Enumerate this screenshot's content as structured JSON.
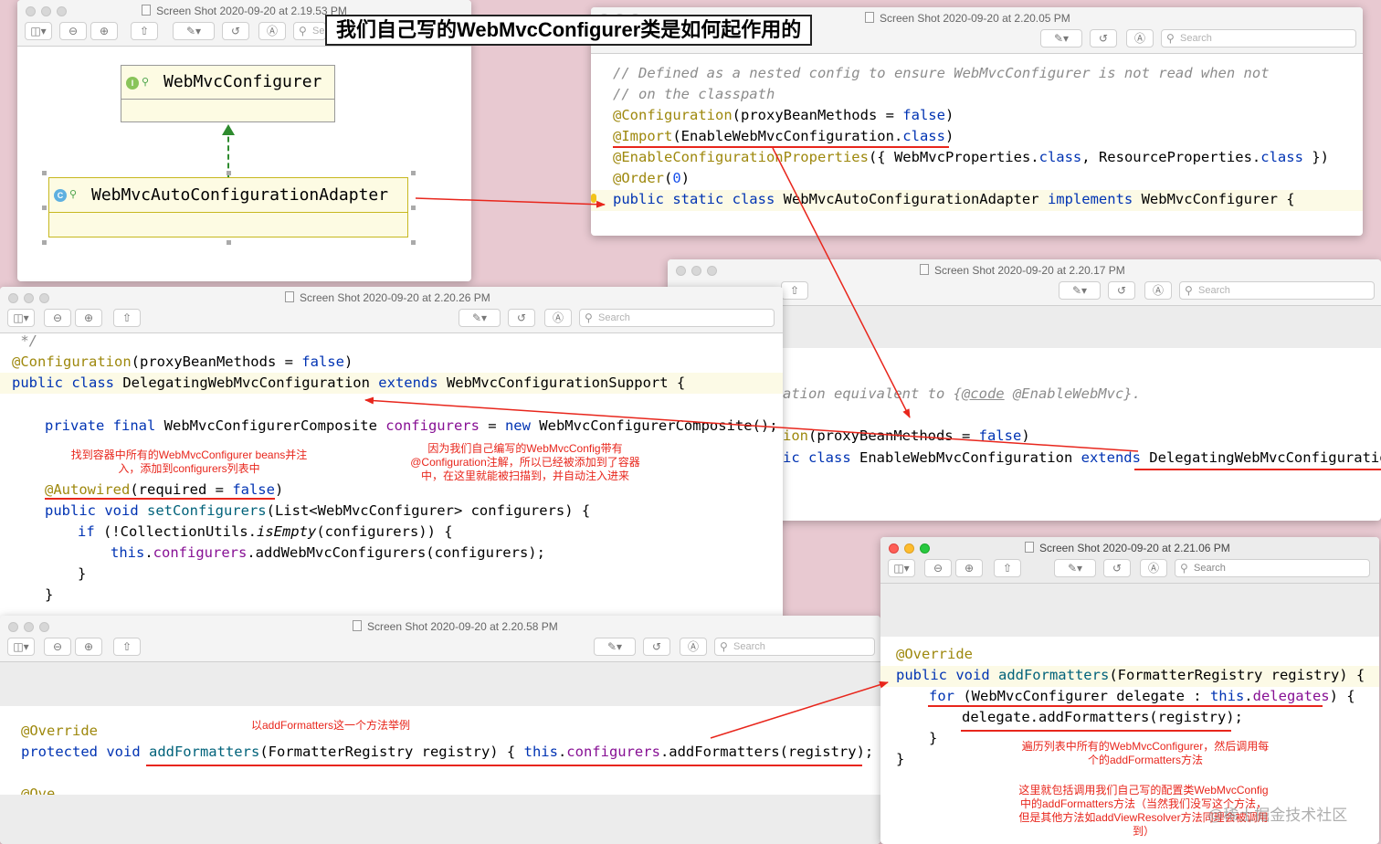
{
  "page_title": "我们自己写的WebMvcConfigurer类是如何起作用的",
  "search_placeholder": "Search",
  "win_diagram": {
    "title": "Screen Shot 2020-09-20 at 2.19.53 PM",
    "interface_badge": "I",
    "class_badge": "C",
    "interface_name": "WebMvcConfigurer",
    "class_name": "WebMvcAutoConfigurationAdapter",
    "search_partial": "Se"
  },
  "win_adapter": {
    "title": "Screen Shot 2020-09-20 at 2.20.05 PM",
    "l1": "// Defined as a nested config to ensure WebMvcConfigurer is not read when not",
    "l2": "// on the classpath",
    "l3a": "@Configuration",
    "l3b": "(proxyBeanMethods = ",
    "l3c": "false",
    "l3d": ")",
    "l4a": "@Import",
    "l4b": "(EnableWebMvcConfiguration.",
    "l4c": "class",
    "l4d": ")",
    "l5a": "@EnableConfigurationProperties",
    "l5b": "({ WebMvcProperties.",
    "l5c": "class",
    "l5d": ", ResourceProperties.",
    "l5e": "class",
    "l5f": " })",
    "l6a": "@Order",
    "l6b": "(",
    "l6c": "0",
    "l6d": ")",
    "l7a": "public static class ",
    "l7b": "WebMvcAutoConfigurationAdapter",
    "l7c": " implements ",
    "l7d": "WebMvcConfigurer {"
  },
  "win_enable": {
    "title": "Screen Shot 2020-09-20 at 2.20.17 PM",
    "l1a": "ation equivalent to {",
    "l1b": "@code",
    "l1c": " @EnableWebMvc}.",
    "l2a": "ion",
    "l2b": "(proxyBeanMethods = ",
    "l2c": "false",
    "l2d": ")",
    "l3a": "ic class ",
    "l3b": "EnableWebMvcConfiguration",
    "l3c": " extends ",
    "l3d": "DelegatingWebMvcConfiguration"
  },
  "win_delegating": {
    "title": "Screen Shot 2020-09-20 at 2.20.26 PM",
    "l0": " */",
    "l1a": "@Configuration",
    "l1b": "(proxyBeanMethods = ",
    "l1c": "false",
    "l1d": ")",
    "l2a": "public class ",
    "l2b": "DelegatingWebMvcConfiguration",
    "l2c": " extends ",
    "l2d": "WebMvcConfigurationSupport {",
    "l3a": "private final ",
    "l3b": "WebMvcConfigurerComposite ",
    "l3c": "configurers",
    "l3d": " = ",
    "l3e": "new ",
    "l3f": "WebMvcConfigurerComposite();",
    "l4a": "@Autowired",
    "l4b": "(required = ",
    "l4c": "false",
    "l4d": ")",
    "l5a": "public void ",
    "l5b": "setConfigurers",
    "l5c": "(List<WebMvcConfigurer> configurers) {",
    "l6a": "if ",
    "l6b": "(!CollectionUtils.",
    "l6c": "isEmpty",
    "l6d": "(configurers)) {",
    "l7a": "this",
    "l7b": ".",
    "l7c": "configurers",
    "l7d": ".addWebMvcConfigurers(configurers);",
    "l8": "}",
    "l9": "}",
    "note1": "找到容器中所有的WebMvcConfigurer beans并注入，添加到configurers列表中",
    "note2": "因为我们自己编写的WebMvcConfig带有@Configuration注解，所以已经被添加到了容器中，在这里就能被扫描到，并自动注入进来"
  },
  "win_override": {
    "title": "Screen Shot 2020-09-20 at 2.20.58 PM",
    "l1": "@Override",
    "l2a": "protected void ",
    "l2b": "addFormatters",
    "l2c": "(FormatterRegistry registry) { ",
    "l2d": "this",
    "l2e": ".",
    "l2f": "configurers",
    "l2g": ".addFormatters(registry); }",
    "l3": "@Override",
    "note": "以addFormatters这一个方法举例"
  },
  "win_composite": {
    "title": "Screen Shot 2020-09-20 at 2.21.06 PM",
    "l1": "@Override",
    "l2a": "public void ",
    "l2b": "addFormatters",
    "l2c": "(FormatterRegistry registry) {",
    "l3a": "for ",
    "l3b": "(WebMvcConfigurer delegate : ",
    "l3c": "this",
    "l3d": ".",
    "l3e": "delegates",
    "l3f": ") {",
    "l4": "delegate.addFormatters(registry);",
    "l5": "}",
    "l6": "}",
    "note1": "遍历列表中所有的WebMvcConfigurer，然后调用每个的addFormatters方法",
    "note2": "这里就包括调用我们自己写的配置类WebMvcConfig中的addFormatters方法（当然我们没写这个方法，但是其他方法如addViewResolver方法同理会被调用到）"
  },
  "watermark": "@稀土掘金技术社区",
  "colors": {
    "background": "#e8c9d1",
    "annotation_red": "#e8261c",
    "keyword_blue": "#0033b3",
    "annotation_olive": "#9e880d",
    "field_purple": "#871094",
    "method_teal": "#00627a"
  }
}
